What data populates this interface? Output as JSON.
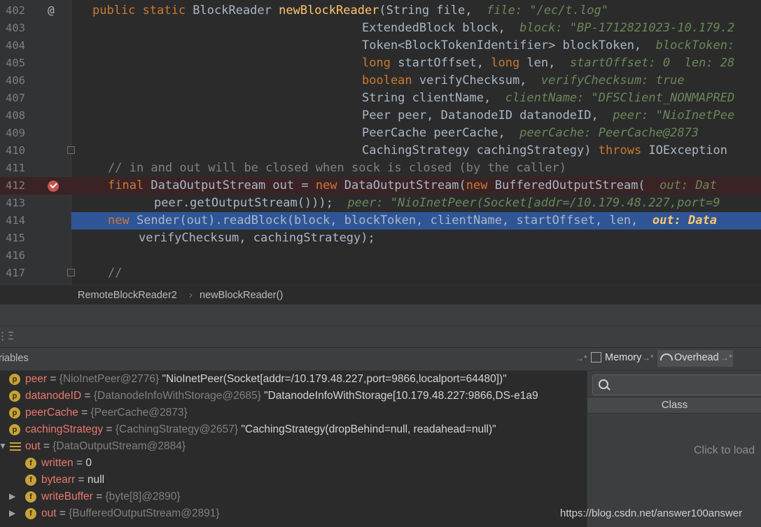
{
  "editor": {
    "lines": [
      {
        "n": "402",
        "gutter": "@"
      },
      {
        "n": "403"
      },
      {
        "n": "404"
      },
      {
        "n": "405"
      },
      {
        "n": "406"
      },
      {
        "n": "407"
      },
      {
        "n": "408"
      },
      {
        "n": "409"
      },
      {
        "n": "410"
      },
      {
        "n": "411"
      },
      {
        "n": "412"
      },
      {
        "n": "413"
      },
      {
        "n": "414"
      },
      {
        "n": "415"
      },
      {
        "n": "416"
      },
      {
        "n": "417"
      }
    ],
    "code": {
      "l402": {
        "a": "public static ",
        "b": "BlockReader ",
        "c": "newBlockReader",
        "d": "(String file,  ",
        "h": "file: \"/ec/t.log\""
      },
      "l403": {
        "a": "ExtendedBlock block,  ",
        "h": "block: \"BP-1712821023-10.179.2"
      },
      "l404": {
        "a": "Token<BlockTokenIdentifier> blockToken,  ",
        "h": "blockToken:"
      },
      "l405": {
        "k1": "long ",
        "a": "startOffset, ",
        "k2": "long ",
        "b": "len,  ",
        "h": "startOffset: 0  len: 28"
      },
      "l406": {
        "k": "boolean ",
        "a": "verifyChecksum,  ",
        "h": "verifyChecksum: true"
      },
      "l407": {
        "a": "String clientName,  ",
        "h": "clientName: \"DFSClient_NONMAPRED"
      },
      "l408": {
        "a": "Peer peer, DatanodeID datanodeID,  ",
        "h": "peer: \"NioInetPee"
      },
      "l409": {
        "a": "PeerCache peerCache,  ",
        "h": "peerCache: PeerCache@2873"
      },
      "l410": {
        "a": "CachingStrategy cachingStrategy) ",
        "k": "throws ",
        "b": "IOException"
      },
      "l411": {
        "c": "// in and out will be closed when sock is closed (by the caller)"
      },
      "l412": {
        "k1": "final ",
        "a": "DataOutputStream out = ",
        "k2": "new ",
        "b": "DataOutputStream(",
        "k3": "new ",
        "c": "BufferedOutputStream(  ",
        "h": "out: Dat"
      },
      "l413": {
        "a": "peer.getOutputStream()));  ",
        "h": "peer: \"NioInetPeer(Socket[addr=/10.179.48.227,port=9"
      },
      "l414": {
        "k": "new ",
        "a": "Sender(out).readBlock(block, blockToken, clientName, startOffset, len,  ",
        "h": "out: Data"
      },
      "l415": {
        "a": "verifyChecksum, cachingStrategy);"
      },
      "l417": {
        "c": "//"
      }
    }
  },
  "breadcrumb": {
    "class": "RemoteBlockReader2",
    "sep": "›",
    "method": "newBlockReader()"
  },
  "panel": {
    "variables_title": "riables",
    "tabs": {
      "memory": "Memory",
      "overhead": "Overhead"
    },
    "search_placeholder": "",
    "class_header": "Class",
    "click_to_load": "Click to load"
  },
  "variables": [
    {
      "badge": "p",
      "name": "peer",
      "type": "{NioInetPeer@2776}",
      "value": "\"NioInetPeer(Socket[addr=/10.179.48.227,port=9866,localport=64480])\""
    },
    {
      "badge": "p",
      "name": "datanodeID",
      "type": "{DatanodeInfoWithStorage@2685}",
      "value": "\"DatanodeInfoWithStorage[10.179.48.227:9866,DS-e1a9"
    },
    {
      "badge": "p",
      "name": "peerCache",
      "type": "{PeerCache@2873}",
      "value": ""
    },
    {
      "badge": "p",
      "name": "cachingStrategy",
      "type": "{CachingStrategy@2657}",
      "value": "\"CachingStrategy(dropBehind=null, readahead=null)\""
    },
    {
      "badge": "",
      "name": "out",
      "type": "{DataOutputStream@2884}",
      "value": ""
    },
    {
      "badge": "f",
      "name": "written",
      "type": "",
      "value": "0"
    },
    {
      "badge": "f",
      "name": "bytearr",
      "type": "",
      "value": "null"
    },
    {
      "badge": "f",
      "name": "writeBuffer",
      "type": "{byte[8]@2890}",
      "value": ""
    },
    {
      "badge": "f",
      "name": "out",
      "type": "{BufferedOutputStream@2891}",
      "value": ""
    }
  ],
  "watermark": "https://blog.csdn.net/answer100answer"
}
